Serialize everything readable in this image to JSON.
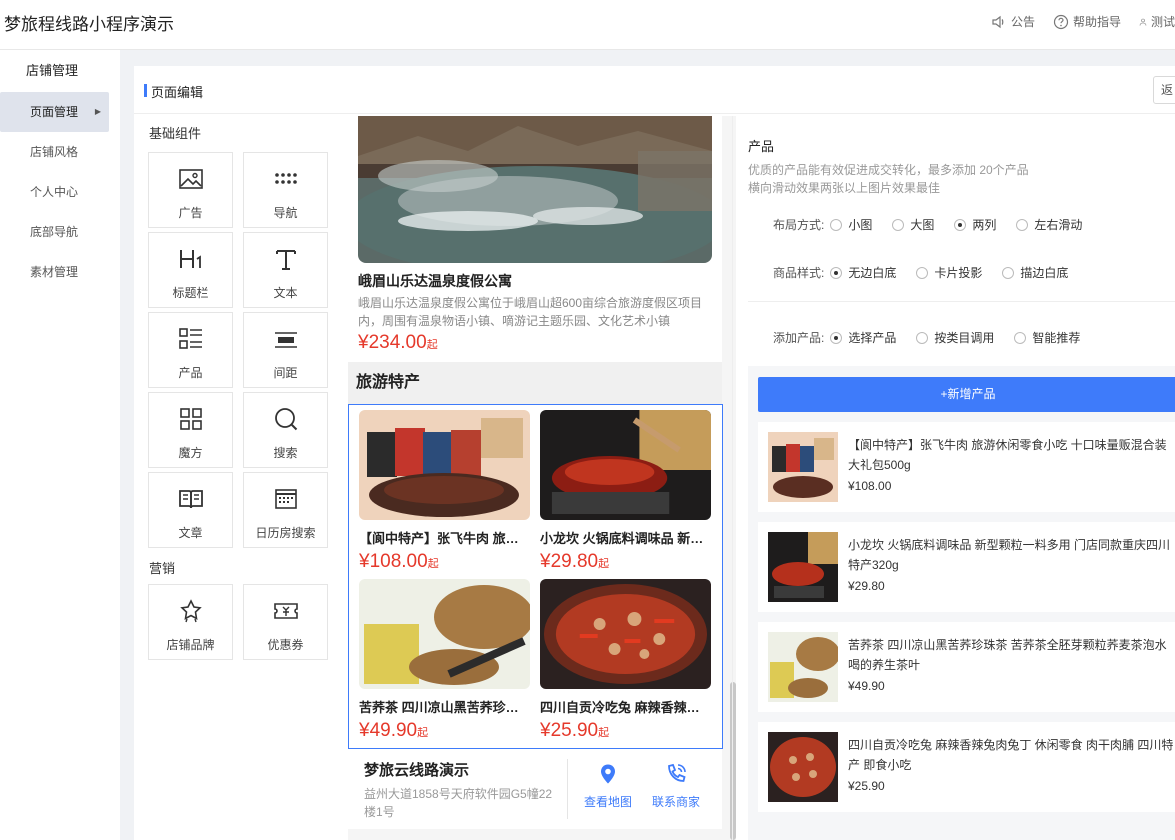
{
  "app": {
    "title": "梦旅程线路小程序演示"
  },
  "top_actions": {
    "announce": "公告",
    "help": "帮助指导",
    "user": "测试"
  },
  "sidebar": {
    "header": "店铺管理",
    "items": [
      {
        "label": "页面管理"
      },
      {
        "label": "店铺风格"
      },
      {
        "label": "个人中心"
      },
      {
        "label": "底部导航"
      },
      {
        "label": "素材管理"
      }
    ]
  },
  "main": {
    "title": "页面编辑",
    "back_label": "返回"
  },
  "components": {
    "basic_title": "基础组件",
    "basic": [
      {
        "label": "广告",
        "icon": "image-icon"
      },
      {
        "label": "导航",
        "icon": "grid-dots-icon"
      },
      {
        "label": "标题栏",
        "icon": "heading-icon"
      },
      {
        "label": "文本",
        "icon": "text-icon"
      },
      {
        "label": "产品",
        "icon": "product-list-icon"
      },
      {
        "label": "间距",
        "icon": "spacing-icon"
      },
      {
        "label": "魔方",
        "icon": "cube-grid-icon"
      },
      {
        "label": "搜索",
        "icon": "search-icon"
      },
      {
        "label": "文章",
        "icon": "book-icon"
      },
      {
        "label": "日历房搜索",
        "icon": "calendar-icon"
      }
    ],
    "marketing_title": "营销",
    "marketing": [
      {
        "label": "店铺品牌",
        "icon": "brand-icon"
      },
      {
        "label": "优惠券",
        "icon": "coupon-icon"
      }
    ]
  },
  "preview": {
    "hotel": {
      "name": "峨眉山乐达温泉度假公寓",
      "desc": "峨眉山乐达温泉度假公寓位于峨眉山超600亩综合旅游度假区项目内，周围有温泉物语小镇、嘀游记主题乐园、文化艺术小镇",
      "price": "234.00"
    },
    "currency": "¥",
    "price_suffix": "起",
    "section_title": "旅游特产",
    "products": [
      {
        "name": "【阆中特产】张飞牛肉 旅游休闲零食小吃 十口味量贩混合装大礼包500g",
        "price": "108.00"
      },
      {
        "name": "小龙坎 火锅底料调味品 新型颗粒一料多用 门店同款重庆四川特产320g",
        "price": "29.80"
      },
      {
        "name": "苦荞茶 四川凉山黑苦荞珍珠茶 苦荞茶全胚芽颗粒荞麦茶泡水喝的养生茶叶",
        "price": "49.90"
      },
      {
        "name": "四川自贡冷吃兔 麻辣香辣兔肉兔丁 休闲零食 肉干肉脯 四川特产 即食小吃",
        "price": "25.90"
      }
    ],
    "footer": {
      "name": "梦旅云线路演示",
      "address": "益州大道1858号天府软件园G5幢22楼1号",
      "map_label": "查看地图",
      "contact_label": "联系商家"
    }
  },
  "settings": {
    "title": "产品",
    "desc_line1": "优质的产品能有效促进成交转化，最多添加 20个产品",
    "desc_line2": "横向滑动效果两张以上图片效果最佳",
    "layout_label": "布局方式:",
    "layout_options": [
      "小图",
      "大图",
      "两列",
      "左右滑动"
    ],
    "layout_selected": "两列",
    "style_label": "商品样式:",
    "style_options": [
      "无边白底",
      "卡片投影",
      "描边白底"
    ],
    "style_selected": "无边白底",
    "add_label": "添加产品:",
    "add_options": [
      "选择产品",
      "按类目调用",
      "智能推荐"
    ],
    "add_selected": "选择产品",
    "add_button": "+新增产品",
    "list": [
      {
        "title": "【阆中特产】张飞牛肉 旅游休闲零食小吃 十口味量贩混合装大礼包500g",
        "price": "¥108.00"
      },
      {
        "title": "小龙坎 火锅底料调味品 新型颗粒一料多用 门店同款重庆四川特产320g",
        "price": "¥29.80"
      },
      {
        "title": "苦荞茶 四川凉山黑苦荞珍珠茶 苦荞茶全胚芽颗粒荞麦茶泡水喝的养生茶叶",
        "price": "¥49.90"
      },
      {
        "title": "四川自贡冷吃兔 麻辣香辣兔肉兔丁 休闲零食 肉干肉脯 四川特产 即食小吃",
        "price": "¥25.90"
      }
    ]
  }
}
